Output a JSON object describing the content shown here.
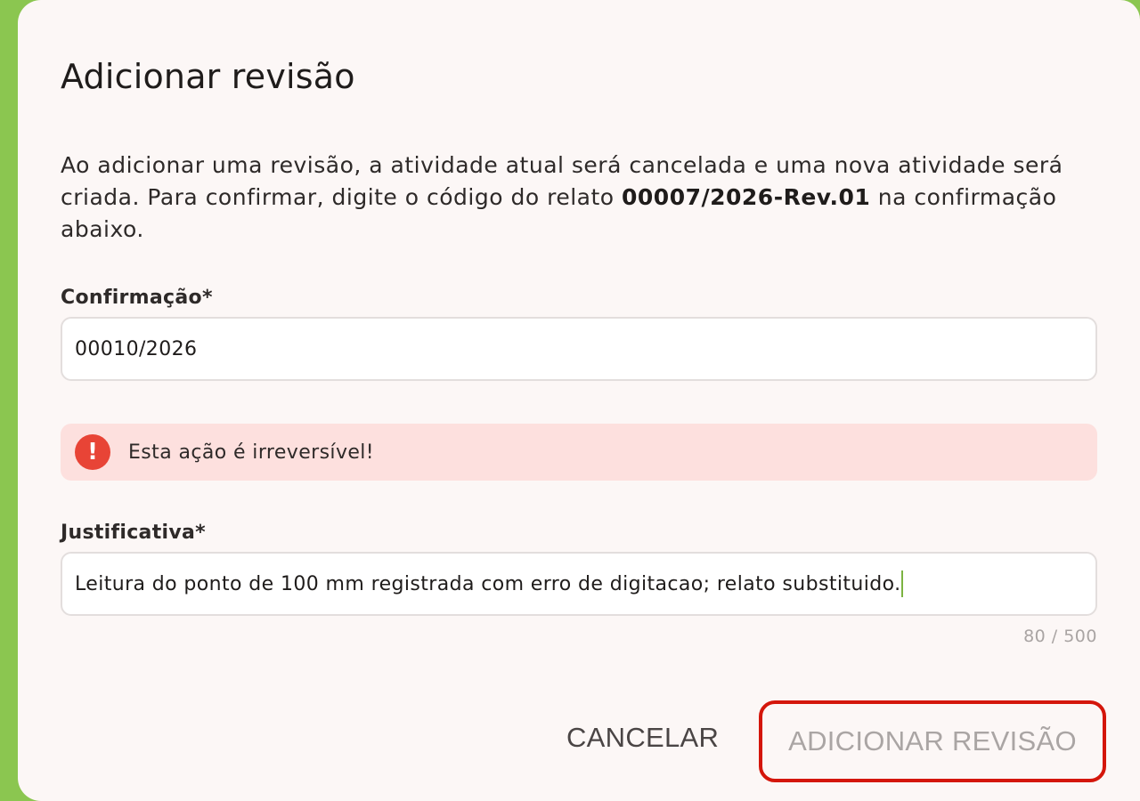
{
  "dialog": {
    "title": "Adicionar revisão",
    "description": {
      "before": "Ao adicionar uma revisão, a atividade atual será cancelada e uma nova atividade será criada. Para confirmar, digite o código do relato ",
      "code": "00007/2026-Rev.01",
      "after": " na confirmação abaixo."
    },
    "confirmation": {
      "label": "Confirmação*",
      "value": "00010/2026"
    },
    "alert": {
      "icon": "exclamation-icon",
      "text": "Esta ação é irreversível!",
      "color": "#e84436"
    },
    "justification": {
      "label": "Justificativa*",
      "value": "Leitura do ponto de 100 mm registrada com erro de digitacao; relato substituido.",
      "counter": "80 / 500"
    },
    "actions": {
      "cancel_label": "CANCELAR",
      "submit_label": "ADICIONAR REVISÃO"
    }
  },
  "colors": {
    "accent": "#8bc650",
    "highlight": "#d4160b",
    "alert_bg": "#fde0de"
  }
}
